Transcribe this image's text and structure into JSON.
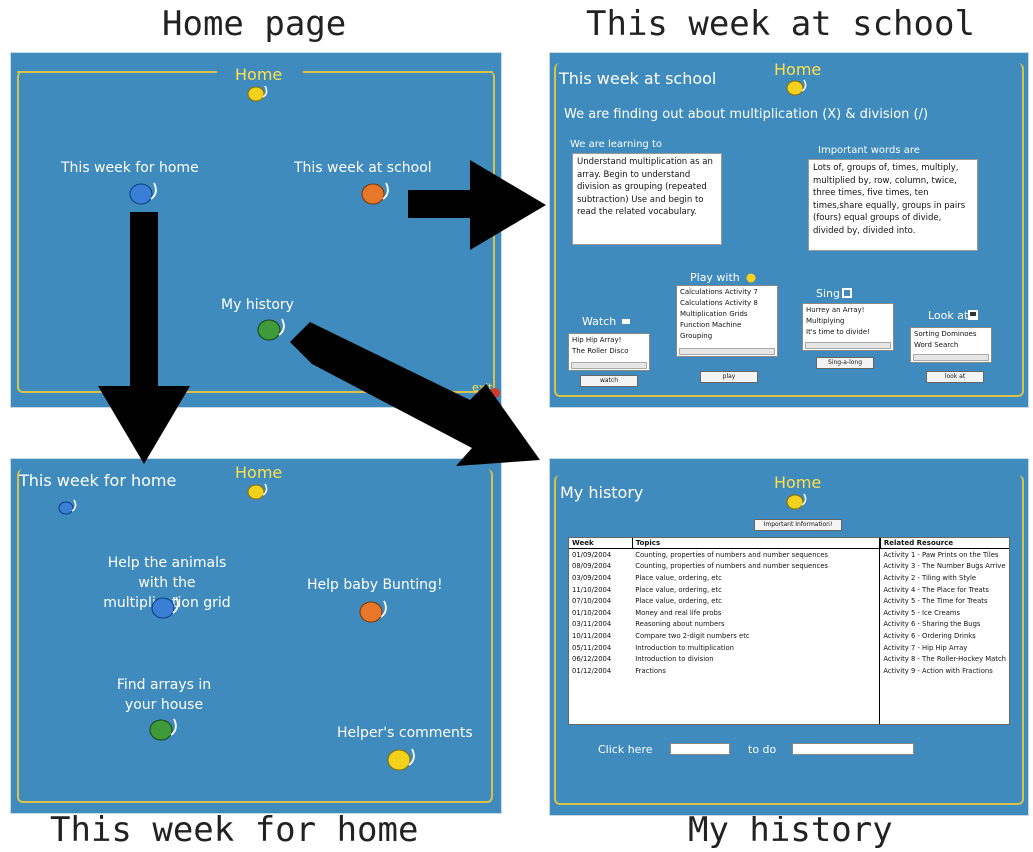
{
  "captions": {
    "home_page": "Home page",
    "this_week_at_school": "This week at school",
    "this_week_for_home": "This week for home",
    "my_history": "My history"
  },
  "home_panel": {
    "home_label": "Home",
    "this_week_for_home": "This week for home",
    "this_week_at_school": "This week at school",
    "my_history": "My history",
    "exit": "exit"
  },
  "school_panel": {
    "title": "This week at school",
    "home_label": "Home",
    "topic": "We are finding out about multiplication (X) & division (/)",
    "learning_heading": "We are learning to",
    "learning_text": "Understand multiplication as an array.  Begin to understand division as grouping (repeated subtraction)  Use and begin to read the related vocabulary.",
    "words_heading": "Important words are",
    "words_text": "Lots of, groups of, times, multiply, multiplied by, row, column, twice, three times, five times,  ten times,share equally, groups in pairs (fours) equal groups of divide, divided by,  divided into.",
    "watch_label": "Watch",
    "watch_items": [
      "Hip Hip Array!",
      "The Roller Disco"
    ],
    "watch_button": "watch",
    "play_label": "Play with",
    "play_items": [
      "Calculations Activity 7",
      "Calculations Activity 8",
      "Multiplication Grids",
      "Function Machine",
      "Grouping"
    ],
    "play_button": "play",
    "sing_label": "Sing",
    "sing_items": [
      "Hurrey an Array!",
      "Multiplying",
      "It's time to divide!"
    ],
    "sing_button": "Sing-a-long",
    "look_label": "Look at",
    "look_items": [
      "Sorting Dominoes",
      "Word Search"
    ],
    "look_button": "look at"
  },
  "home_week_panel": {
    "title": "This week for home",
    "home_label": "Home",
    "item1": "Help the animals with the multiplication grid",
    "item2": "Help baby Bunting!",
    "item3": "Find arrays in your house",
    "item4": "Helper's comments"
  },
  "history_panel": {
    "title": "My history",
    "home_label": "Home",
    "important_button": "Important Information!",
    "columns": [
      "Week",
      "Topics",
      "Related Resource"
    ],
    "rows": [
      [
        "01/09/2004",
        "Counting, properties of numbers and number sequences",
        "Activity 1 - Paw Prints on the Tiles"
      ],
      [
        "08/09/2004",
        "Counting, properties of numbers and number sequences",
        "Activity 3 - The Number Bugs Arrive"
      ],
      [
        "03/09/2004",
        "Place value, ordering, etc",
        "Activity 2 - Tiling with Style"
      ],
      [
        "11/10/2004",
        "Place value, ordering, etc",
        "Activity 4 - The Place for Treats"
      ],
      [
        "07/10/2004",
        "Place value, ordering, etc",
        "Activity 5 - The Time for Treats"
      ],
      [
        "01/10/2004",
        "Money and real life probs",
        "Activity 5 - Ice Creams"
      ],
      [
        "03/11/2004",
        "Reasoning about numbers",
        "Activity 6 - Sharing the Bugs"
      ],
      [
        "10/11/2004",
        "Compare two 2-digit numbers etc",
        "Activity 6 - Ordering Drinks"
      ],
      [
        "05/11/2004",
        "Introduction to multiplication",
        "Activity 7 - Hip Hip Array"
      ],
      [
        "06/12/2004",
        "Introduction to division",
        "Activity 8 - The Roller-Hockey Match"
      ],
      [
        "01/12/2004",
        "Fractions",
        "Activity 9 - Action with Fractions"
      ]
    ],
    "click_here": "Click here",
    "to_do": "to do"
  },
  "colors": {
    "panel_bg": "#3f8bbd",
    "frame_gold": "#d9c24a",
    "home_yellow": "#ffe14a",
    "arrow": "#000000"
  }
}
